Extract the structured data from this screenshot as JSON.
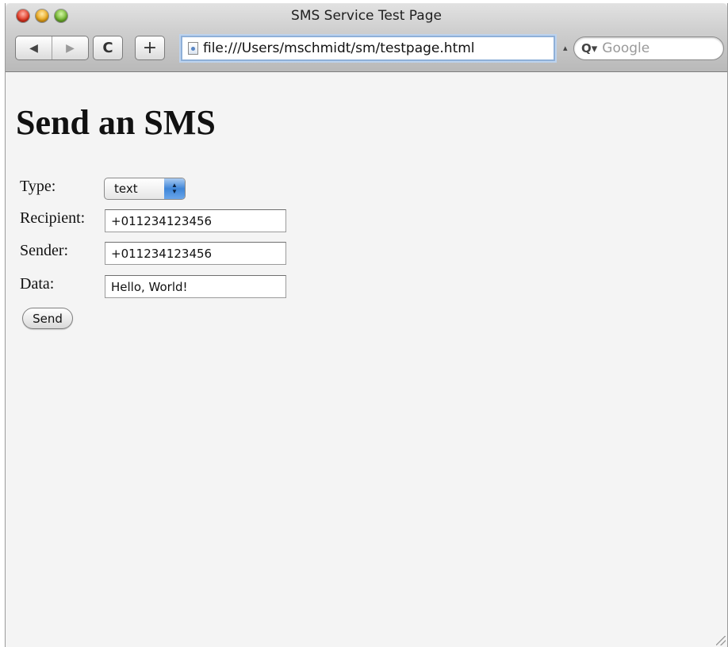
{
  "window": {
    "title": "SMS Service Test Page"
  },
  "toolbar": {
    "back_icon": "◀",
    "forward_icon": "▶",
    "reload_icon": "C",
    "add_bookmark_icon": "+",
    "url": "file:///Users/mschmidt/sm/testpage.html",
    "search_icon": "Q▾",
    "search_placeholder": "Google"
  },
  "page": {
    "heading": "Send an SMS",
    "form": {
      "type_label": "Type:",
      "type_value": "text",
      "recipient_label": "Recipient:",
      "recipient_value": "+011234123456",
      "sender_label": "Sender:",
      "sender_value": "+011234123456",
      "data_label": "Data:",
      "data_value": "Hello, World!",
      "send_label": "Send"
    }
  },
  "colors": {
    "page_background": "#f4f4f4",
    "select_accent": "#3f86d8",
    "url_focus_ring": "#8fb0d8"
  }
}
